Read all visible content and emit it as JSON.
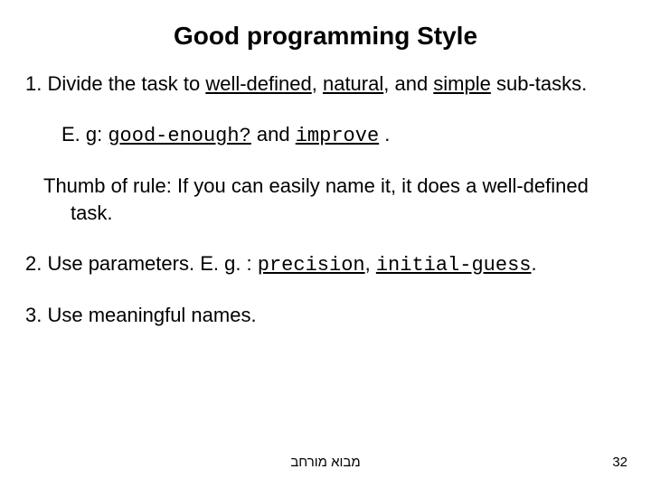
{
  "title": "Good programming Style",
  "p1": {
    "prefix": "1. Divide the task to ",
    "u1": "well-defined",
    "sep1": ", ",
    "u2": "natural",
    "sep2": ", and ",
    "u3": "simple",
    "suffix": " sub-tasks."
  },
  "p2": {
    "prefix": "E. g: ",
    "c1": "good-enough?",
    "mid": " and ",
    "c2": "improve",
    "suffix": " ."
  },
  "p3": "Thumb of rule: If you can easily name it, it does a well-defined task.",
  "p4": {
    "prefix": "2. Use parameters. E. g. : ",
    "c1": "precision",
    "sep": ", ",
    "c2": "initial-guess",
    "suffix": "."
  },
  "p5": "3. Use meaningful names.",
  "footer_center": "מבוא מורחב",
  "page_number": "32"
}
